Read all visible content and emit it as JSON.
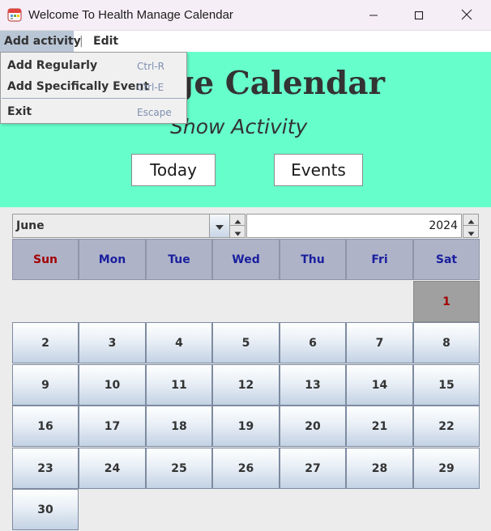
{
  "window": {
    "title": "Welcome To Health Manage Calendar",
    "icons": [
      "calendar-icon",
      "minimize-icon",
      "maximize-icon",
      "close-icon"
    ]
  },
  "menubar": {
    "items": [
      "Add activity",
      "|",
      "Edit"
    ]
  },
  "dropdown": {
    "items": [
      {
        "label": "Add Regularly",
        "accelerator": "Ctrl-R"
      },
      {
        "label": "Add Specifically Event",
        "accelerator": "Ctrl-E"
      },
      {
        "label": "Exit",
        "accelerator": "Escape"
      }
    ]
  },
  "header": {
    "title": "Manage Calendar",
    "subtitle": "Show Activity",
    "buttons": [
      "Today",
      "Events"
    ]
  },
  "calendar": {
    "month": "June",
    "year": "2024",
    "weekdays": [
      "Sun",
      "Mon",
      "Tue",
      "Wed",
      "Thu",
      "Fri",
      "Sat"
    ],
    "first_weekday_index": 6,
    "days_in_month": 30,
    "selected_day": "1",
    "days": [
      "1",
      "2",
      "3",
      "4",
      "5",
      "6",
      "7",
      "8",
      "9",
      "10",
      "11",
      "12",
      "13",
      "14",
      "15",
      "16",
      "17",
      "18",
      "19",
      "20",
      "21",
      "22",
      "23",
      "24",
      "25",
      "26",
      "27",
      "28",
      "29",
      "30"
    ]
  },
  "colors": {
    "header_bg": "#66ffcc",
    "weekday_header_bg": "#aeb3c8",
    "weekday_text": "#1a1f9e",
    "sunday_text": "#a30000",
    "selected_day_bg": "#a0a0a0",
    "menu_highlight": "#b9c6d6"
  }
}
